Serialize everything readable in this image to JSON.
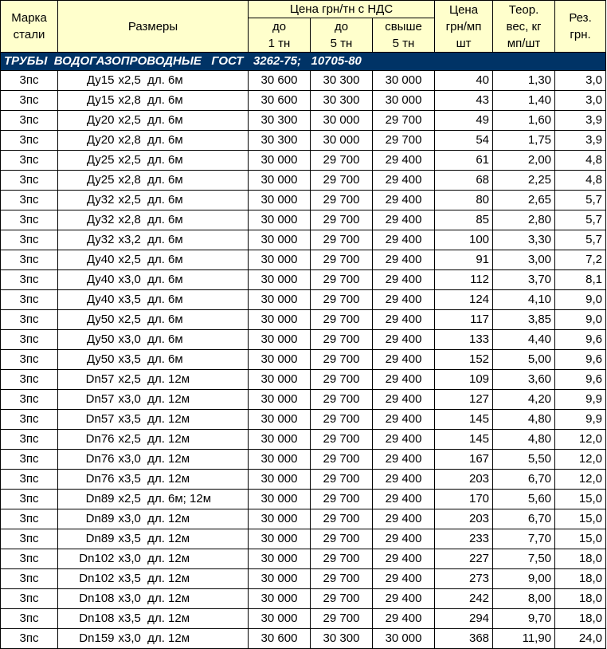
{
  "header": {
    "steel_grade": [
      "Марка",
      "стали"
    ],
    "sizes": "Размеры",
    "price_group": "Цена грн/тн с НДС",
    "up_to_1": [
      "до",
      "1 тн"
    ],
    "up_to_5": [
      "до",
      "5 тн"
    ],
    "over_5": [
      "свыше",
      "5 тн"
    ],
    "price_per_m": [
      "Цена",
      "грн/мп",
      "шт"
    ],
    "weight": [
      "Теор.",
      "вес, кг",
      "мп/шт"
    ],
    "cut": [
      "Рез.",
      "грн."
    ]
  },
  "section_title": "ТРУБЫ  ВОДОГАЗОПРОВОДНЫЕ   ГОСТ   3262-75;   10705-80",
  "rows": [
    {
      "grade": "3пс",
      "dn": "Ду15",
      "spec": "х2,5  дл. 6м",
      "p1": "30 600",
      "p5": "30 300",
      "p5p": "30 000",
      "pm": "40",
      "w": "1,30",
      "cut": "3,0"
    },
    {
      "grade": "3пс",
      "dn": "Ду15",
      "spec": "х2,8  дл. 6м",
      "p1": "30 600",
      "p5": "30 300",
      "p5p": "30 000",
      "pm": "43",
      "w": "1,40",
      "cut": "3,0"
    },
    {
      "grade": "3пс",
      "dn": "Ду20",
      "spec": "х2,5  дл. 6м",
      "p1": "30 300",
      "p5": "30 000",
      "p5p": "29 700",
      "pm": "49",
      "w": "1,60",
      "cut": "3,9"
    },
    {
      "grade": "3пс",
      "dn": "Ду20",
      "spec": "х2,8  дл. 6м",
      "p1": "30 300",
      "p5": "30 000",
      "p5p": "29 700",
      "pm": "54",
      "w": "1,75",
      "cut": "3,9"
    },
    {
      "grade": "3пс",
      "dn": "Ду25",
      "spec": "х2,5  дл. 6м",
      "p1": "30 000",
      "p5": "29 700",
      "p5p": "29 400",
      "pm": "61",
      "w": "2,00",
      "cut": "4,8"
    },
    {
      "grade": "3пс",
      "dn": "Ду25",
      "spec": "х2,8  дл. 6м",
      "p1": "30 000",
      "p5": "29 700",
      "p5p": "29 400",
      "pm": "68",
      "w": "2,25",
      "cut": "4,8"
    },
    {
      "grade": "3пс",
      "dn": "Ду32",
      "spec": "х2,5  дл. 6м",
      "p1": "30 000",
      "p5": "29 700",
      "p5p": "29 400",
      "pm": "80",
      "w": "2,65",
      "cut": "5,7"
    },
    {
      "grade": "3пс",
      "dn": "Ду32",
      "spec": "х2,8  дл. 6м",
      "p1": "30 000",
      "p5": "29 700",
      "p5p": "29 400",
      "pm": "85",
      "w": "2,80",
      "cut": "5,7"
    },
    {
      "grade": "3пс",
      "dn": "Ду32",
      "spec": "х3,2  дл. 6м",
      "p1": "30 000",
      "p5": "29 700",
      "p5p": "29 400",
      "pm": "100",
      "w": "3,30",
      "cut": "5,7"
    },
    {
      "grade": "3пс",
      "dn": "Ду40",
      "spec": "х2,5  дл. 6м",
      "p1": "30 000",
      "p5": "29 700",
      "p5p": "29 400",
      "pm": "91",
      "w": "3,00",
      "cut": "7,2"
    },
    {
      "grade": "3пс",
      "dn": "Ду40",
      "spec": "х3,0  дл. 6м",
      "p1": "30 000",
      "p5": "29 700",
      "p5p": "29 400",
      "pm": "112",
      "w": "3,70",
      "cut": "8,1"
    },
    {
      "grade": "3пс",
      "dn": "Ду40",
      "spec": "х3,5  дл. 6м",
      "p1": "30 000",
      "p5": "29 700",
      "p5p": "29 400",
      "pm": "124",
      "w": "4,10",
      "cut": "9,0"
    },
    {
      "grade": "3пс",
      "dn": "Ду50",
      "spec": "х2,5  дл. 6м",
      "p1": "30 000",
      "p5": "29 700",
      "p5p": "29 400",
      "pm": "117",
      "w": "3,85",
      "cut": "9,0"
    },
    {
      "grade": "3пс",
      "dn": "Ду50",
      "spec": "х3,0  дл. 6м",
      "p1": "30 000",
      "p5": "29 700",
      "p5p": "29 400",
      "pm": "133",
      "w": "4,40",
      "cut": "9,6"
    },
    {
      "grade": "3пс",
      "dn": "Ду50",
      "spec": "х3,5  дл. 6м",
      "p1": "30 000",
      "p5": "29 700",
      "p5p": "29 400",
      "pm": "152",
      "w": "5,00",
      "cut": "9,6"
    },
    {
      "grade": "3пс",
      "dn": "Dn57",
      "spec": "х2,5  дл. 12м",
      "p1": "30 000",
      "p5": "29 700",
      "p5p": "29 400",
      "pm": "109",
      "w": "3,60",
      "cut": "9,6"
    },
    {
      "grade": "3пс",
      "dn": "Dn57",
      "spec": "х3,0  дл. 12м",
      "p1": "30 000",
      "p5": "29 700",
      "p5p": "29 400",
      "pm": "127",
      "w": "4,20",
      "cut": "9,9"
    },
    {
      "grade": "3пс",
      "dn": "Dn57",
      "spec": "х3,5  дл. 12м",
      "p1": "30 000",
      "p5": "29 700",
      "p5p": "29 400",
      "pm": "145",
      "w": "4,80",
      "cut": "9,9"
    },
    {
      "grade": "3пс",
      "dn": "Dn76",
      "spec": "х2,5  дл. 12м",
      "p1": "30 000",
      "p5": "29 700",
      "p5p": "29 400",
      "pm": "145",
      "w": "4,80",
      "cut": "12,0"
    },
    {
      "grade": "3пс",
      "dn": "Dn76",
      "spec": "х3,0  дл. 12м",
      "p1": "30 000",
      "p5": "29 700",
      "p5p": "29 400",
      "pm": "167",
      "w": "5,50",
      "cut": "12,0"
    },
    {
      "grade": "3пс",
      "dn": "Dn76",
      "spec": "х3,5  дл. 12м",
      "p1": "30 000",
      "p5": "29 700",
      "p5p": "29 400",
      "pm": "203",
      "w": "6,70",
      "cut": "12,0"
    },
    {
      "grade": "3пс",
      "dn": "Dn89",
      "spec": "х2,5  дл. 6м; 12м",
      "p1": "30 000",
      "p5": "29 700",
      "p5p": "29 400",
      "pm": "170",
      "w": "5,60",
      "cut": "15,0"
    },
    {
      "grade": "3пс",
      "dn": "Dn89",
      "spec": "х3,0  дл. 12м",
      "p1": "30 000",
      "p5": "29 700",
      "p5p": "29 400",
      "pm": "203",
      "w": "6,70",
      "cut": "15,0"
    },
    {
      "grade": "3пс",
      "dn": "Dn89",
      "spec": "х3,5  дл. 12м",
      "p1": "30 000",
      "p5": "29 700",
      "p5p": "29 400",
      "pm": "233",
      "w": "7,70",
      "cut": "15,0"
    },
    {
      "grade": "3пс",
      "dn": "Dn102",
      "spec": "х3,0  дл. 12м",
      "p1": "30 000",
      "p5": "29 700",
      "p5p": "29 400",
      "pm": "227",
      "w": "7,50",
      "cut": "18,0"
    },
    {
      "grade": "3пс",
      "dn": "Dn102",
      "spec": "х3,5  дл. 12м",
      "p1": "30 000",
      "p5": "29 700",
      "p5p": "29 400",
      "pm": "273",
      "w": "9,00",
      "cut": "18,0"
    },
    {
      "grade": "3пс",
      "dn": "Dn108",
      "spec": "х3,0  дл. 12м",
      "p1": "30 000",
      "p5": "29 700",
      "p5p": "29 400",
      "pm": "242",
      "w": "8,00",
      "cut": "18,0"
    },
    {
      "grade": "3пс",
      "dn": "Dn108",
      "spec": "х3,5  дл. 12м",
      "p1": "30 000",
      "p5": "29 700",
      "p5p": "29 400",
      "pm": "294",
      "w": "9,70",
      "cut": "18,0"
    },
    {
      "grade": "3пс",
      "dn": "Dn159",
      "spec": "х3,0  дл. 12м",
      "p1": "30 600",
      "p5": "30 300",
      "p5p": "30 000",
      "pm": "368",
      "w": "11,90",
      "cut": "24,0"
    }
  ]
}
